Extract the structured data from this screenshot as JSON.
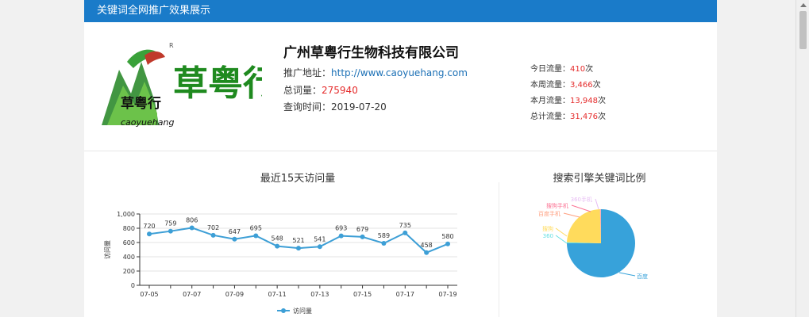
{
  "header": {
    "title": "关键词全网推广效果展示"
  },
  "company": {
    "name": "广州草粤行生物科技有限公司",
    "logo_text": "草粤行",
    "logo_script": "草粤行",
    "logo_pinyin": "caoyuehang",
    "logo_mark": "R",
    "url_label": "推广地址：",
    "url": "http://www.caoyuehang.com",
    "words_label": "总词量：",
    "words": "275940",
    "date_label": "查询时间：",
    "date": "2019-07-20"
  },
  "stats": [
    {
      "label": "今日流量：",
      "value": "410",
      "unit": "次"
    },
    {
      "label": "本周流量：",
      "value": "3,466",
      "unit": "次"
    },
    {
      "label": "本月流量：",
      "value": "13,948",
      "unit": "次"
    },
    {
      "label": "总计流量：",
      "value": "31,476",
      "unit": "次"
    }
  ],
  "colors": {
    "header": "#1a7bc9",
    "line": "#3d9fd6",
    "pie_baidu": "#37a2da",
    "pie_360": "#67e0e3",
    "pie_sogou": "#ffdb5c",
    "pie_baidu_mobile": "#ff9f7f",
    "pie_sogou_mobile": "#fb7293",
    "pie_360_mobile": "#e7bcf3"
  },
  "chart_data": [
    {
      "type": "line",
      "title": "最近15天访问量",
      "ylabel": "访问量",
      "xlabel": "",
      "x": [
        "07-05",
        "07-06",
        "07-07",
        "07-08",
        "07-09",
        "07-10",
        "07-11",
        "07-12",
        "07-13",
        "07-14",
        "07-15",
        "07-16",
        "07-17",
        "07-18",
        "07-19"
      ],
      "xtick_labels": [
        "07-05",
        "07-07",
        "07-09",
        "07-11",
        "07-13",
        "07-15",
        "07-17",
        "07-19"
      ],
      "ytick_labels": [
        "0",
        "200",
        "400",
        "600",
        "800",
        "1,000"
      ],
      "series": [
        {
          "name": "访问量",
          "values": [
            720,
            759,
            806,
            702,
            647,
            695,
            548,
            521,
            541,
            693,
            679,
            589,
            735,
            458,
            580
          ]
        }
      ],
      "ylim": [
        0,
        1000
      ],
      "grid": true,
      "legend": "bottom"
    },
    {
      "type": "pie",
      "title": "搜索引擎关键词比例",
      "slices": [
        {
          "name": "百度",
          "value": 75
        },
        {
          "name": "360",
          "value": 0.5
        },
        {
          "name": "搜狗",
          "value": 24
        },
        {
          "name": "百度手机",
          "value": 0.2
        },
        {
          "name": "搜狗手机",
          "value": 0.2
        },
        {
          "name": "360手机",
          "value": 0.1
        }
      ]
    }
  ]
}
